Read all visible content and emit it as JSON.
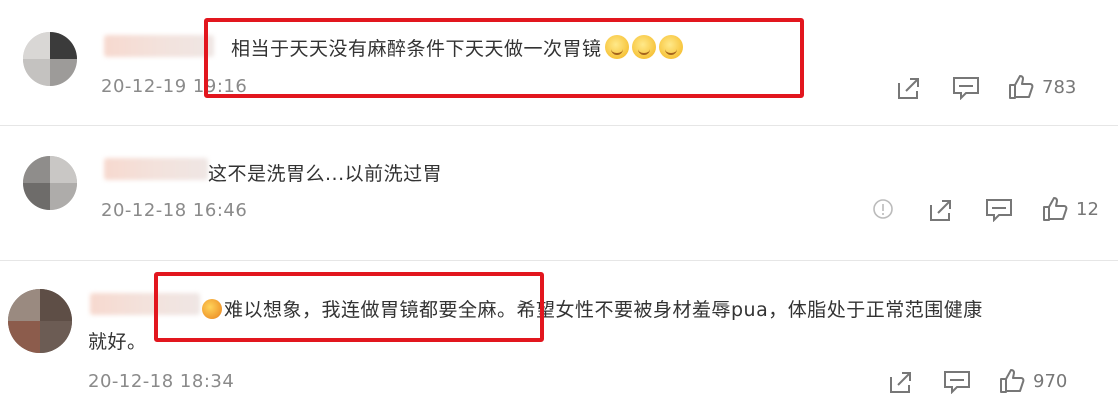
{
  "comments": [
    {
      "text": "相当于天天没有麻醉条件下天天做一次胃镜",
      "time": "20-12-19 19:16",
      "likes": "783"
    },
    {
      "text": "这不是洗胃么...以前洗过胃",
      "time": "20-12-18 16:46",
      "likes": "12"
    },
    {
      "text_line1": "难以想象，我连做胃镜都要全麻。希望女性不要被身材羞辱pua，体脂处于正常范围健康",
      "text_line2": "就好。",
      "time": "20-12-18 18:34",
      "likes": "970"
    }
  ],
  "icons": {
    "share": "share-icon",
    "reply": "comment-icon",
    "like": "thumbs-up-icon",
    "report": "report-icon",
    "emoji": "emoji-icon"
  },
  "colors": {
    "highlight_box": "#e2161e",
    "text": "#333333",
    "meta": "#8a8a8a"
  }
}
